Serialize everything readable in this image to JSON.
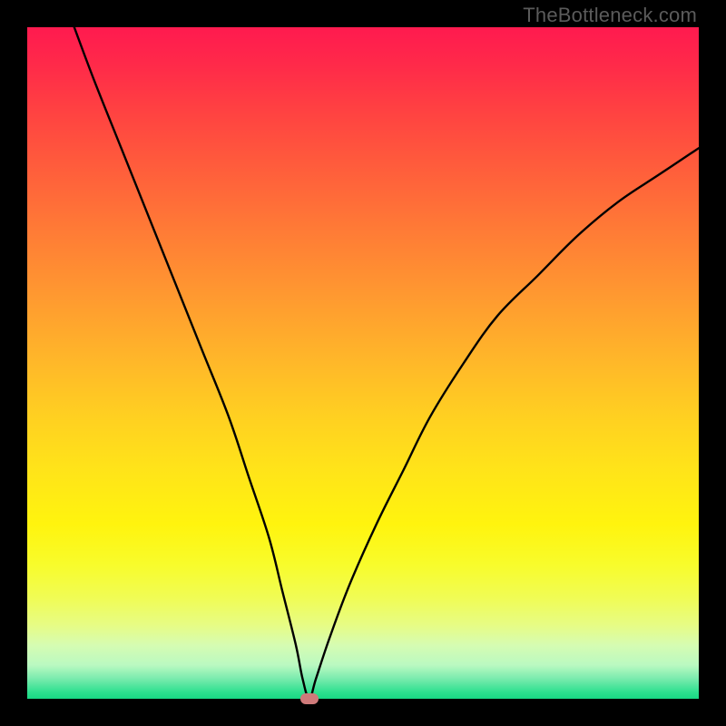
{
  "watermark": "TheBottleneck.com",
  "chart_data": {
    "type": "line",
    "title": "",
    "xlabel": "",
    "ylabel": "",
    "xlim": [
      0,
      100
    ],
    "ylim": [
      0,
      100
    ],
    "grid": false,
    "legend": false,
    "annotations": [],
    "background_gradient": {
      "orientation": "vertical",
      "stops": [
        {
          "pct": 0,
          "color": "#ff1a4f"
        },
        {
          "pct": 50,
          "color": "#ffb829"
        },
        {
          "pct": 80,
          "color": "#f8fc2b"
        },
        {
          "pct": 100,
          "color": "#18d884"
        }
      ],
      "meaning": "top = high bottleneck, bottom = no bottleneck"
    },
    "series": [
      {
        "name": "bottleneck-curve",
        "type": "line",
        "color": "#000000",
        "x": [
          7,
          10,
          14,
          18,
          22,
          26,
          30,
          33,
          36,
          38,
          40,
          41,
          42,
          43,
          45,
          48,
          52,
          56,
          60,
          65,
          70,
          76,
          82,
          88,
          94,
          100
        ],
        "y": [
          100,
          92,
          82,
          72,
          62,
          52,
          42,
          33,
          24,
          16,
          8,
          3,
          0,
          3,
          9,
          17,
          26,
          34,
          42,
          50,
          57,
          63,
          69,
          74,
          78,
          82
        ]
      }
    ],
    "minimum_marker": {
      "x": 42,
      "y": 0,
      "color": "#cf7a7a",
      "shape": "rounded-rect"
    }
  }
}
